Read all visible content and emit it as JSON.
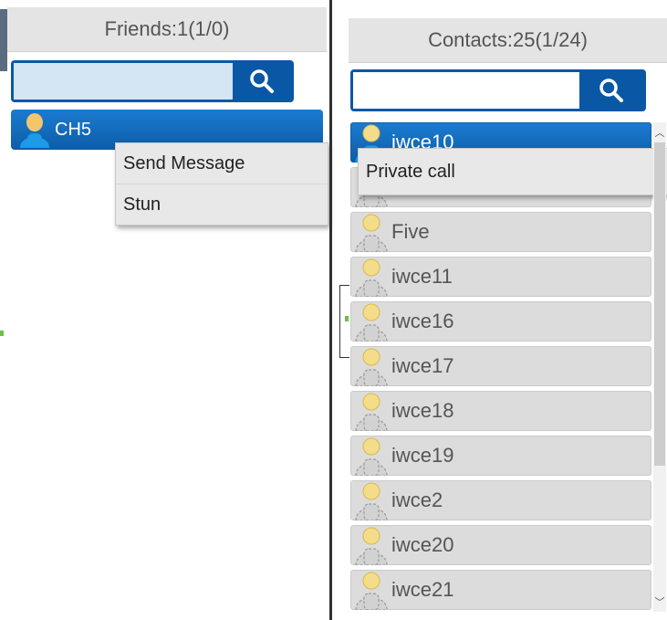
{
  "friends": {
    "header": "Friends:1(1/0)",
    "search": {
      "value": "",
      "placeholder": ""
    },
    "items": [
      {
        "name": "CH5",
        "icon": "user-icon-blue"
      }
    ],
    "context_menu": {
      "items": [
        "Send Message",
        "Stun"
      ]
    }
  },
  "contacts": {
    "header": "Contacts:25(1/24)",
    "search": {
      "value": "",
      "placeholder": ""
    },
    "items": [
      {
        "name": "iwce10",
        "selected": true
      },
      {
        "name": ""
      },
      {
        "name": "Five"
      },
      {
        "name": "iwce11"
      },
      {
        "name": "iwce16"
      },
      {
        "name": "iwce17"
      },
      {
        "name": "iwce18"
      },
      {
        "name": "iwce19"
      },
      {
        "name": "iwce2"
      },
      {
        "name": "iwce20"
      },
      {
        "name": "iwce21"
      }
    ],
    "context_menu": {
      "items": [
        "Private call"
      ]
    }
  },
  "colors": {
    "accent": "#0d5da8",
    "selected_row": "#1b7bd0",
    "row_bg": "#dcdcdc",
    "header_bg": "#e4e4e4"
  },
  "icons": {
    "search": "search-icon",
    "user": "user-icon"
  }
}
